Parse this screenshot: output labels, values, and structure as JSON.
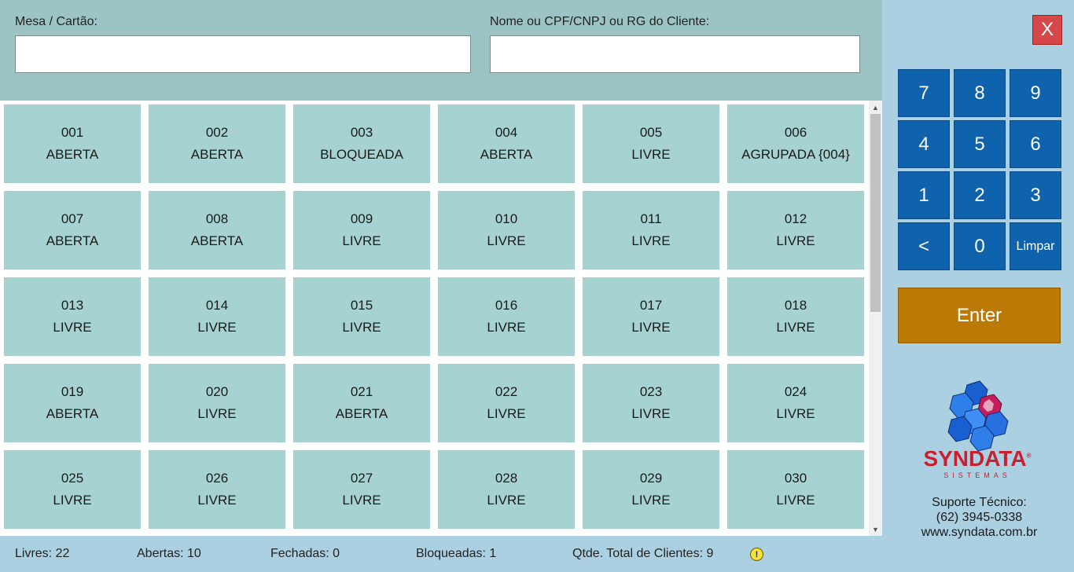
{
  "header": {
    "table_label": "Mesa / Cartão:",
    "table_value": "",
    "client_label": "Nome ou CPF/CNPJ ou RG do Cliente:",
    "client_value": ""
  },
  "tables": [
    {
      "number": "001",
      "status": "ABERTA"
    },
    {
      "number": "002",
      "status": "ABERTA"
    },
    {
      "number": "003",
      "status": "BLOQUEADA"
    },
    {
      "number": "004",
      "status": "ABERTA"
    },
    {
      "number": "005",
      "status": "LIVRE"
    },
    {
      "number": "006",
      "status": "AGRUPADA {004}"
    },
    {
      "number": "007",
      "status": "ABERTA"
    },
    {
      "number": "008",
      "status": "ABERTA"
    },
    {
      "number": "009",
      "status": "LIVRE"
    },
    {
      "number": "010",
      "status": "LIVRE"
    },
    {
      "number": "011",
      "status": "LIVRE"
    },
    {
      "number": "012",
      "status": "LIVRE"
    },
    {
      "number": "013",
      "status": "LIVRE"
    },
    {
      "number": "014",
      "status": "LIVRE"
    },
    {
      "number": "015",
      "status": "LIVRE"
    },
    {
      "number": "016",
      "status": "LIVRE"
    },
    {
      "number": "017",
      "status": "LIVRE"
    },
    {
      "number": "018",
      "status": "LIVRE"
    },
    {
      "number": "019",
      "status": "ABERTA"
    },
    {
      "number": "020",
      "status": "LIVRE"
    },
    {
      "number": "021",
      "status": "ABERTA"
    },
    {
      "number": "022",
      "status": "LIVRE"
    },
    {
      "number": "023",
      "status": "LIVRE"
    },
    {
      "number": "024",
      "status": "LIVRE"
    },
    {
      "number": "025",
      "status": "LIVRE"
    },
    {
      "number": "026",
      "status": "LIVRE"
    },
    {
      "number": "027",
      "status": "LIVRE"
    },
    {
      "number": "028",
      "status": "LIVRE"
    },
    {
      "number": "029",
      "status": "LIVRE"
    },
    {
      "number": "030",
      "status": "LIVRE"
    }
  ],
  "status_bar": {
    "livres": "Livres: 22",
    "abertas": "Abertas: 10",
    "fechadas": "Fechadas: 0",
    "bloqueadas": "Bloqueadas: 1",
    "total_clientes": "Qtde. Total de Clientes: 9",
    "warning_symbol": "!"
  },
  "close_label": "X",
  "keypad": [
    "7",
    "8",
    "9",
    "4",
    "5",
    "6",
    "1",
    "2",
    "3",
    "<",
    "0",
    "Limpar"
  ],
  "enter_label": "Enter",
  "brand": {
    "name": "SYNDATA",
    "sub": "SISTEMAS",
    "registered": "®"
  },
  "support": {
    "title": "Suporte Técnico:",
    "phone": "(62) 3945-0338",
    "site": "www.syndata.com.br"
  },
  "colors": {
    "tile": "#a7d2d2",
    "key": "#0f63ad",
    "enter": "#bb7a06",
    "close": "#d6474a",
    "brand": "#c8202f"
  }
}
